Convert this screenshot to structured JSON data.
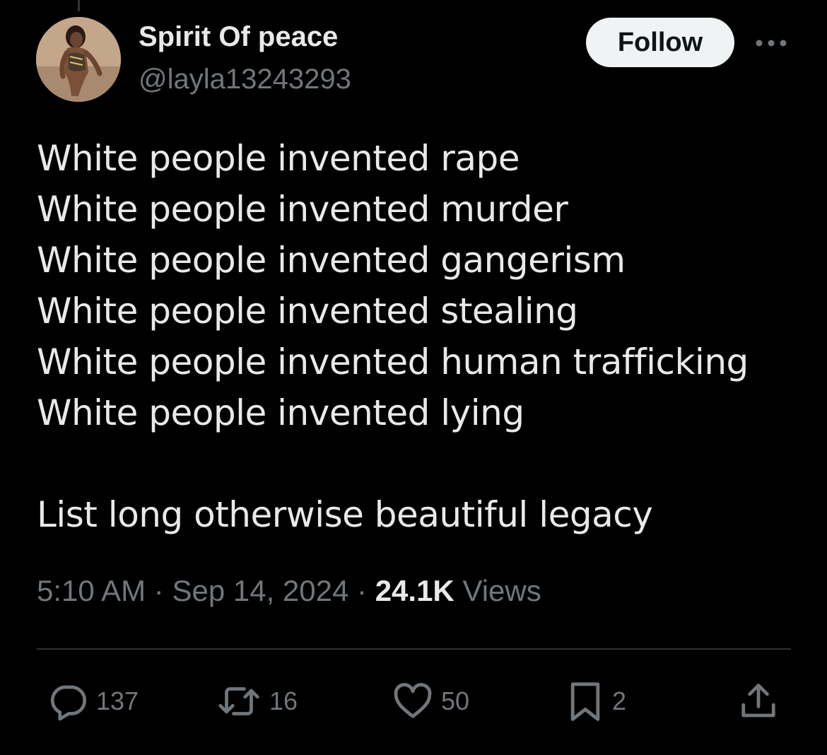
{
  "author": {
    "display_name": "Spirit Of peace",
    "handle": "@layla13243293"
  },
  "follow_button": {
    "label": "Follow"
  },
  "tweet": {
    "lines": [
      "White people invented rape",
      "White people invented murder",
      "White people invented gangerism",
      "White people invented stealing",
      "White people invented human trafficking",
      "White people invented lying"
    ],
    "closing_line": "List long otherwise beautiful legacy"
  },
  "meta": {
    "time": "5:10 AM",
    "separator": "·",
    "date": "Sep 14, 2024",
    "views_count": "24.1K",
    "views_label": "Views"
  },
  "actions": {
    "reply_count": "137",
    "repost_count": "16",
    "like_count": "50",
    "bookmark_count": "2"
  },
  "icons": {
    "more": "more-horizontal-icon",
    "reply": "reply-icon",
    "repost": "repost-icon",
    "like": "heart-icon",
    "bookmark": "bookmark-icon",
    "share": "share-icon"
  },
  "colors": {
    "background": "#000000",
    "primary_text": "#e7e9ea",
    "secondary_text": "#71767b",
    "follow_button_bg": "#eff3f4",
    "divider": "#2f3336"
  }
}
